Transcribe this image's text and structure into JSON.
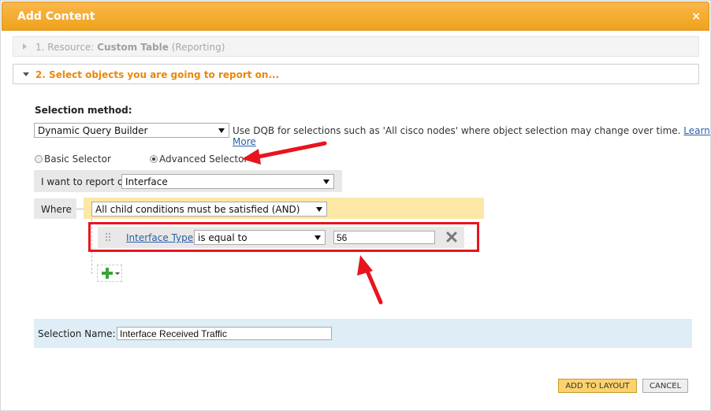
{
  "dialog": {
    "title": "Add Content",
    "close_glyph": "×"
  },
  "steps": {
    "step1": {
      "prefix": "1. Resource: ",
      "resource": "Custom Table",
      "suffix": "(Reporting)"
    },
    "step2": {
      "label": "2. Select objects you are going to report on..."
    }
  },
  "selection_method": {
    "label": "Selection method:",
    "value": "Dynamic Query Builder",
    "description": "Use DQB for selections such as 'All cisco nodes' where object selection may change over time.",
    "learn_more": "Learn More"
  },
  "selector": {
    "basic_label": "Basic Selector",
    "advanced_label": "Advanced Selector",
    "selected": "advanced"
  },
  "report_on": {
    "label": "I want to report on",
    "value": "Interface"
  },
  "where": {
    "label": "Where",
    "logic_value": "All child conditions must be satisfied (AND)"
  },
  "condition": {
    "field": "Interface Type",
    "operator": "is equal to",
    "value": "56"
  },
  "selection_name": {
    "label": "Selection Name:",
    "value": "Interface Received Traffic"
  },
  "buttons": {
    "add_to_layout": "ADD TO LAYOUT",
    "cancel": "CANCEL"
  },
  "colors": {
    "title_bar": "#f0a21c",
    "step2_text": "#e8880c",
    "and_group": "#fde7a4",
    "selection_name_bg": "#deedf6",
    "annotation": "#e8141e"
  }
}
